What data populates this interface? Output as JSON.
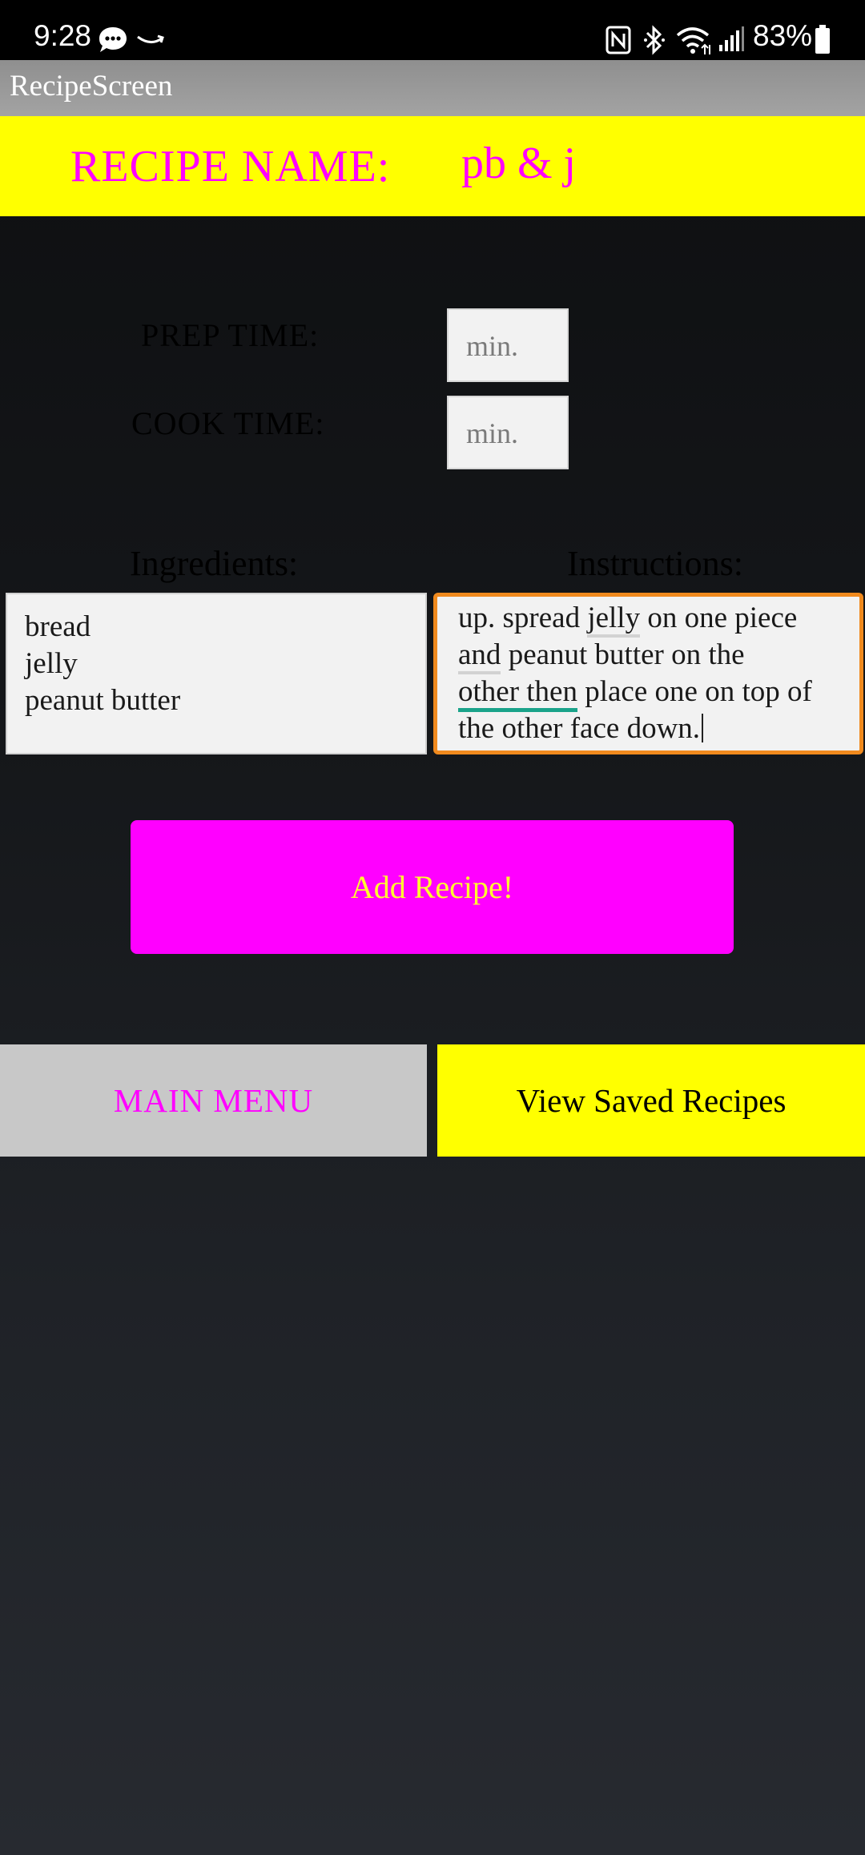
{
  "status_bar": {
    "time": "9:28",
    "battery": "83%",
    "icons": [
      "chat-bubble-icon",
      "amazon-smile-icon",
      "nfc-icon",
      "bluetooth-icon",
      "wifi-icon",
      "signal-icon",
      "battery-icon"
    ]
  },
  "app_bar": {
    "title": "RecipeScreen"
  },
  "recipe": {
    "name_label": "RECIPE NAME:",
    "name_value": "pb & j"
  },
  "times": {
    "prep_label": "PREP TIME:",
    "prep_placeholder": "min.",
    "cook_label": "COOK TIME:",
    "cook_placeholder": "min."
  },
  "ingredients": {
    "label": "Ingredients:",
    "lines": [
      "bread",
      "jelly",
      "peanut butter"
    ]
  },
  "instructions": {
    "label": "Instructions:",
    "seg": {
      "l1a": "up. spread ",
      "l1b": "jelly",
      "l1c": " on one piece",
      "l2a": "and",
      "l2b": " peanut butter on the",
      "l3a": "other then",
      "l3b": " place one on top of",
      "l4a": "the other face down."
    }
  },
  "actions": {
    "add_recipe": "Add Recipe!",
    "main_menu": "MAIN MENU",
    "view_saved": "View Saved Recipes"
  },
  "colors": {
    "accent_magenta": "#ff00ff",
    "accent_yellow": "#ffff00",
    "focus_orange": "#f08a1e"
  }
}
